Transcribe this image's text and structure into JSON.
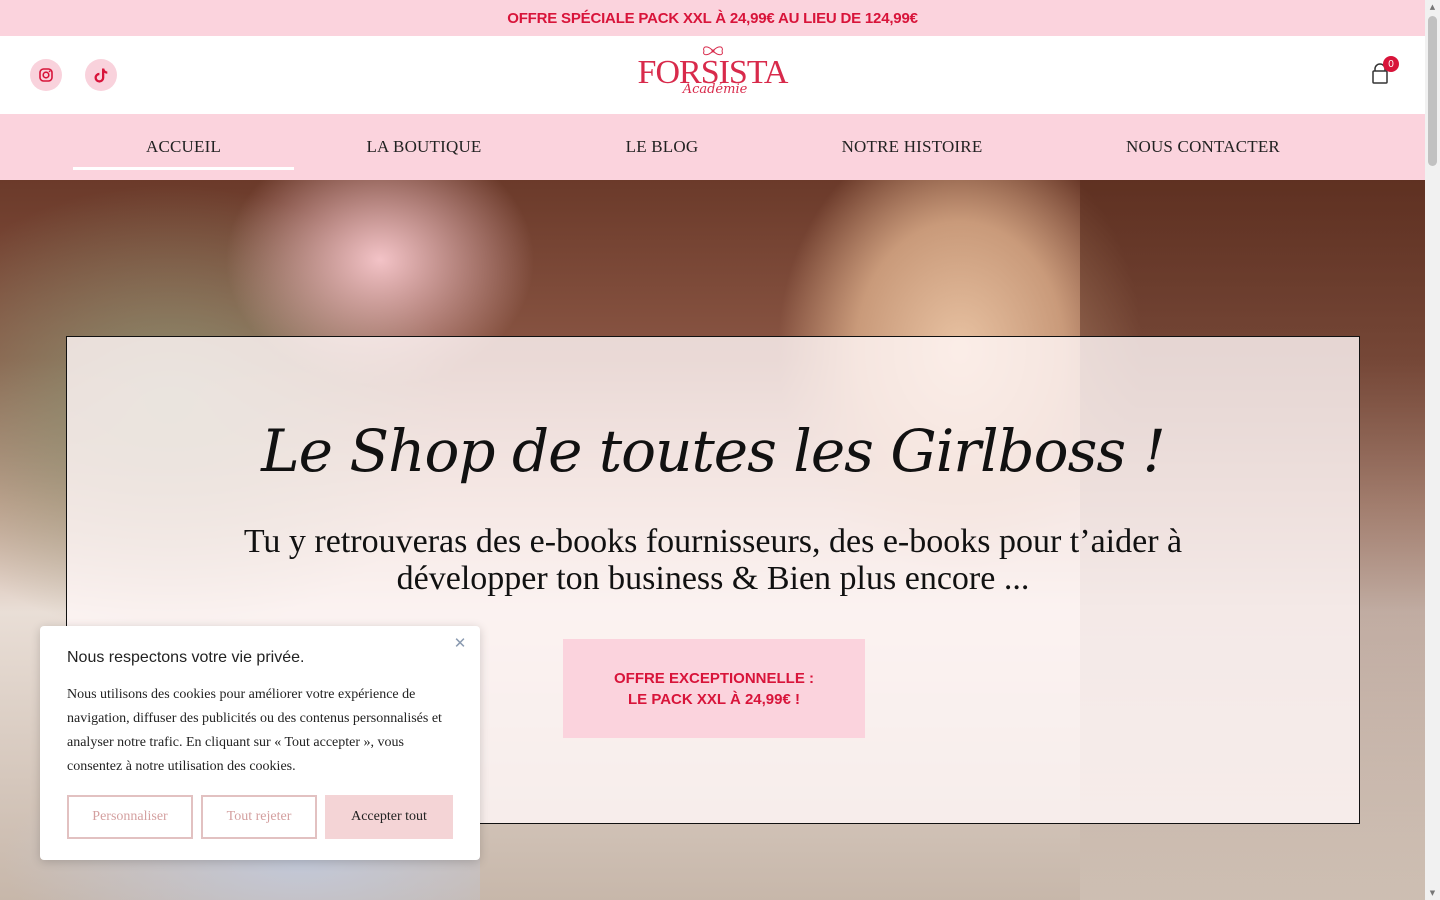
{
  "announcement": {
    "text": "OFFRE SPÉCIALE PACK XXL À 24,99€ AU LIEU DE 124,99€"
  },
  "header": {
    "logo_main": "FORSISTA",
    "logo_sub": "Académie",
    "cart_count": "0",
    "social": [
      "instagram-icon",
      "tiktok-icon"
    ]
  },
  "nav": {
    "items": [
      {
        "label": "ACCUEIL",
        "active": true
      },
      {
        "label": "LA BOUTIQUE"
      },
      {
        "label": "LE BLOG"
      },
      {
        "label": "NOTRE HISTOIRE"
      },
      {
        "label": "NOUS CONTACTER"
      }
    ]
  },
  "hero": {
    "title": "Le Shop de toutes les Girlboss !",
    "subtitle": "Tu y retrouveras des e-books fournisseurs, des e-books pour t’aider à développer ton business & Bien plus encore ...",
    "cta": "OFFRE EXCEPTIONNELLE : LE PACK XXL À 24,99€ !"
  },
  "cookie": {
    "title": "Nous respectons votre vie privée.",
    "text": "Nous utilisons des cookies pour améliorer votre expérience de navigation, diffuser des publicités ou des contenus personnalisés et analyser notre trafic. En cliquant sur « Tout accepter », vous consentez à notre utilisation des cookies.",
    "customize": "Personnaliser",
    "reject": "Tout rejeter",
    "accept": "Accepter tout"
  },
  "colors": {
    "pink": "#fbd3dd",
    "accent": "#d8143a"
  }
}
